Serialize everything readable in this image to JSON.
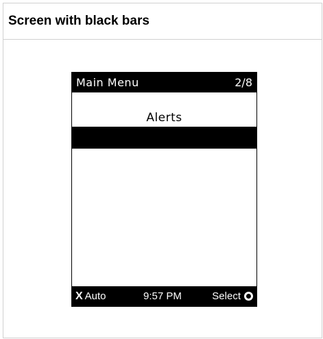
{
  "header": {
    "title": "Screen with black bars"
  },
  "device": {
    "top_bar": {
      "title": "Main Menu",
      "page": "2/8"
    },
    "menu_item": "Alerts",
    "bottom_bar": {
      "left_label": "Auto",
      "left_icon": "x-icon",
      "time": "9:57 PM",
      "right_label": "Select",
      "right_icon": "circle-icon"
    }
  }
}
